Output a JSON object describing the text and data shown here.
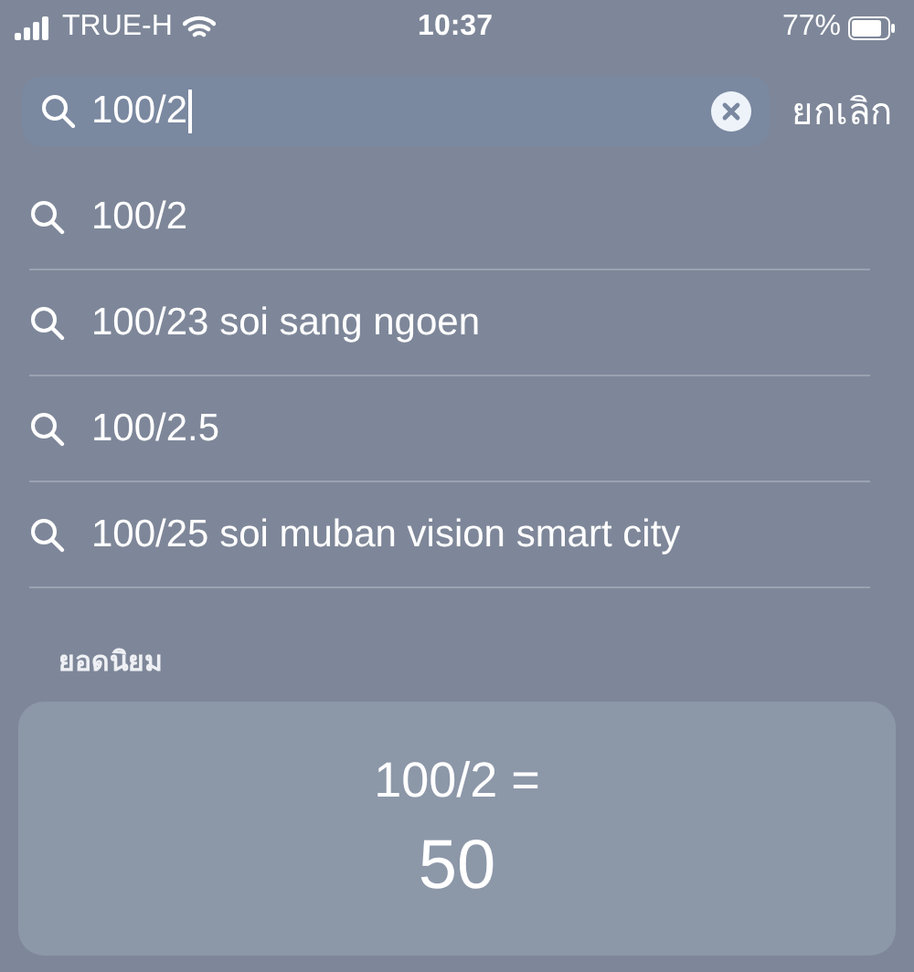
{
  "status_bar": {
    "carrier": "TRUE-H",
    "time": "10:37",
    "battery": "77%"
  },
  "search": {
    "value": "100/2",
    "cancel": "ยกเลิก"
  },
  "suggestions": [
    {
      "text": "100/2"
    },
    {
      "text": "100/23 soi sang ngoen"
    },
    {
      "text": "100/2.5"
    },
    {
      "text": "100/25 soi muban vision smart city"
    }
  ],
  "top_hit": {
    "heading": "ยอดนิยม",
    "expression": "100/2 =",
    "result": "50"
  }
}
